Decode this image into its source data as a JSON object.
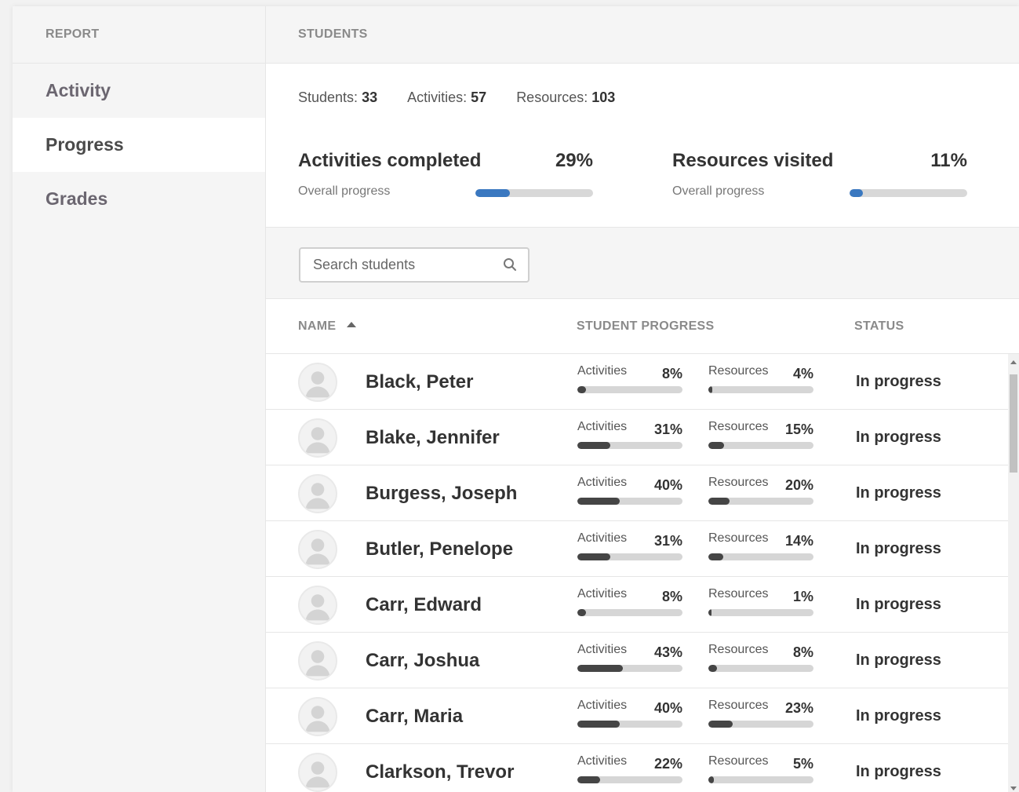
{
  "sidebar": {
    "header": "REPORT",
    "items": [
      {
        "label": "Activity",
        "active": false
      },
      {
        "label": "Progress",
        "active": true
      },
      {
        "label": "Grades",
        "active": false
      }
    ]
  },
  "main": {
    "header": "STUDENTS",
    "counts": {
      "students_label": "Students:",
      "students_value": "33",
      "activities_label": "Activities:",
      "activities_value": "57",
      "resources_label": "Resources:",
      "resources_value": "103"
    },
    "summary": {
      "activities": {
        "title": "Activities completed",
        "pct": "29%",
        "sub": "Overall progress",
        "fraction": 0.29
      },
      "resources": {
        "title": "Resources visited",
        "pct": "11%",
        "sub": "Overall progress",
        "fraction": 0.11
      }
    },
    "accent_color": "#3a78c0",
    "search": {
      "placeholder": "Search students"
    },
    "columns": {
      "name": "NAME",
      "progress": "STUDENT PROGRESS",
      "status": "STATUS"
    },
    "progress_labels": {
      "activities": "Activities",
      "resources": "Resources"
    },
    "students": [
      {
        "name": "Black, Peter",
        "activities_pct": "8%",
        "activities": 0.08,
        "resources_pct": "4%",
        "resources": 0.04,
        "status": "In progress"
      },
      {
        "name": "Blake, Jennifer",
        "activities_pct": "31%",
        "activities": 0.31,
        "resources_pct": "15%",
        "resources": 0.15,
        "status": "In progress"
      },
      {
        "name": "Burgess, Joseph",
        "activities_pct": "40%",
        "activities": 0.4,
        "resources_pct": "20%",
        "resources": 0.2,
        "status": "In progress"
      },
      {
        "name": "Butler, Penelope",
        "activities_pct": "31%",
        "activities": 0.31,
        "resources_pct": "14%",
        "resources": 0.14,
        "status": "In progress"
      },
      {
        "name": "Carr, Edward",
        "activities_pct": "8%",
        "activities": 0.08,
        "resources_pct": "1%",
        "resources": 0.01,
        "status": "In progress"
      },
      {
        "name": "Carr, Joshua",
        "activities_pct": "43%",
        "activities": 0.43,
        "resources_pct": "8%",
        "resources": 0.08,
        "status": "In progress"
      },
      {
        "name": "Carr, Maria",
        "activities_pct": "40%",
        "activities": 0.4,
        "resources_pct": "23%",
        "resources": 0.23,
        "status": "In progress"
      },
      {
        "name": "Clarkson, Trevor",
        "activities_pct": "22%",
        "activities": 0.22,
        "resources_pct": "5%",
        "resources": 0.05,
        "status": "In progress"
      }
    ]
  }
}
